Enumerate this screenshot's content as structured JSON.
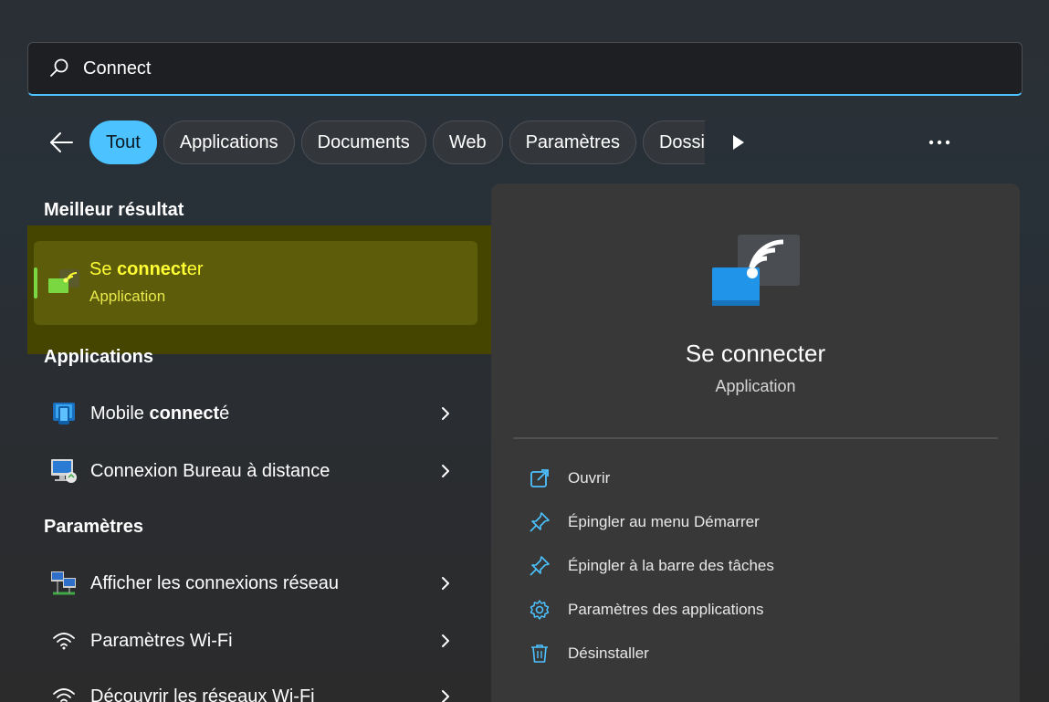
{
  "search": {
    "query": "Connect"
  },
  "filters": {
    "chips": [
      {
        "label": "Tout",
        "active": true
      },
      {
        "label": "Applications",
        "active": false
      },
      {
        "label": "Documents",
        "active": false
      },
      {
        "label": "Web",
        "active": false
      },
      {
        "label": "Paramètres",
        "active": false
      },
      {
        "label": "Dossiers",
        "active": false
      }
    ]
  },
  "best_match": {
    "section_label": "Meilleur résultat",
    "title_prefix": "Se ",
    "title_bold": "connect",
    "title_suffix": "er",
    "subtitle": "Application"
  },
  "apps": {
    "section_label": "Applications",
    "items": [
      {
        "prefix": "Mobile ",
        "bold": "connect",
        "suffix": "é",
        "icon": "mobile-connected-icon"
      },
      {
        "prefix": "Connexion Bureau à distance",
        "bold": "",
        "suffix": "",
        "icon": "remote-desktop-icon"
      }
    ]
  },
  "settings": {
    "section_label": "Paramètres",
    "items": [
      {
        "label": "Afficher les connexions réseau",
        "icon": "network-connections-icon"
      },
      {
        "label": "Paramètres Wi-Fi",
        "icon": "wifi-icon"
      },
      {
        "label": "Découvrir les réseaux Wi-Fi",
        "icon": "wifi-icon"
      }
    ]
  },
  "preview": {
    "title": "Se connecter",
    "subtitle": "Application",
    "actions": [
      {
        "label": "Ouvrir",
        "icon": "open-external-icon"
      },
      {
        "label": "Épingler au menu Démarrer",
        "icon": "pin-icon"
      },
      {
        "label": "Épingler à la barre des tâches",
        "icon": "pin-icon"
      },
      {
        "label": "Paramètres des applications",
        "icon": "gear-icon"
      },
      {
        "label": "Désinstaller",
        "icon": "trash-icon"
      }
    ]
  },
  "colors": {
    "accent": "#4cc2ff",
    "highlight": "#5c5c0a",
    "highlight_text": "#ffff33"
  }
}
